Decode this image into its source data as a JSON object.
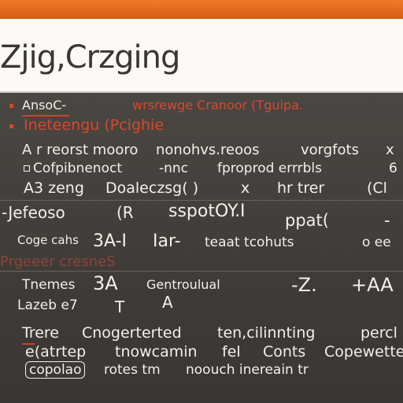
{
  "window": {
    "title": "Zjig,Crzging"
  },
  "content": {
    "row1": {
      "left": "AnsoC-",
      "right": "wrsrewge Cranoor (Tguipa."
    },
    "row2": {
      "text": "Ineteengu (Pcighie"
    },
    "row3": {
      "left": "A r reorst mooro",
      "mid": "nonohvs.reoos",
      "right": "vorgfots",
      "tail": "x"
    },
    "row4": {
      "left": "Cofpibnenoct",
      "mid": "-nnc",
      "right": "fproprod errrbls",
      "tail": "6"
    },
    "row5": {
      "left": "A3 zeng",
      "mid": "Doaleczsg( )",
      "x": "x",
      "right": "hr trer",
      "tail": "(Cl"
    },
    "row6": {
      "left": "-Jefeoso",
      "mid": "(R",
      "right": "sspotOY.I"
    },
    "row6b": {
      "right": "ppat(",
      "tail": "-"
    },
    "row7": {
      "left": "Coge cahs",
      "mid": "3A-I",
      "mid2": "Iar-",
      "right": "teaat tcohuts",
      "tail": "o ee"
    },
    "row8": {
      "text": "Prgeeer cresneS"
    },
    "row9": {
      "left": "Tnemes",
      "mid": "3A",
      "right": "Gentroulual",
      "math": "-Z.",
      "tail": "+AA"
    },
    "row10": {
      "left": "Lazeb e7",
      "mid": "T",
      "right": "A"
    },
    "row11": {
      "left": "Trere",
      "mid": "Cnogerterted",
      "mid2": "ten,cilinnting",
      "tail": "percl"
    },
    "row12": {
      "left": "e(atrtep",
      "mid": "tnowcamin",
      "mid2": "fel",
      "right": "Conts",
      "tail": "Copewette"
    },
    "row13": {
      "pill": "copolao",
      "mid": "rotes tm",
      "right": "noouch inereain tr"
    }
  },
  "colors": {
    "accent": "#e8772a",
    "red_text": "#d64a2b",
    "background": "#3b3835",
    "title_bg": "#fbfaf8"
  }
}
